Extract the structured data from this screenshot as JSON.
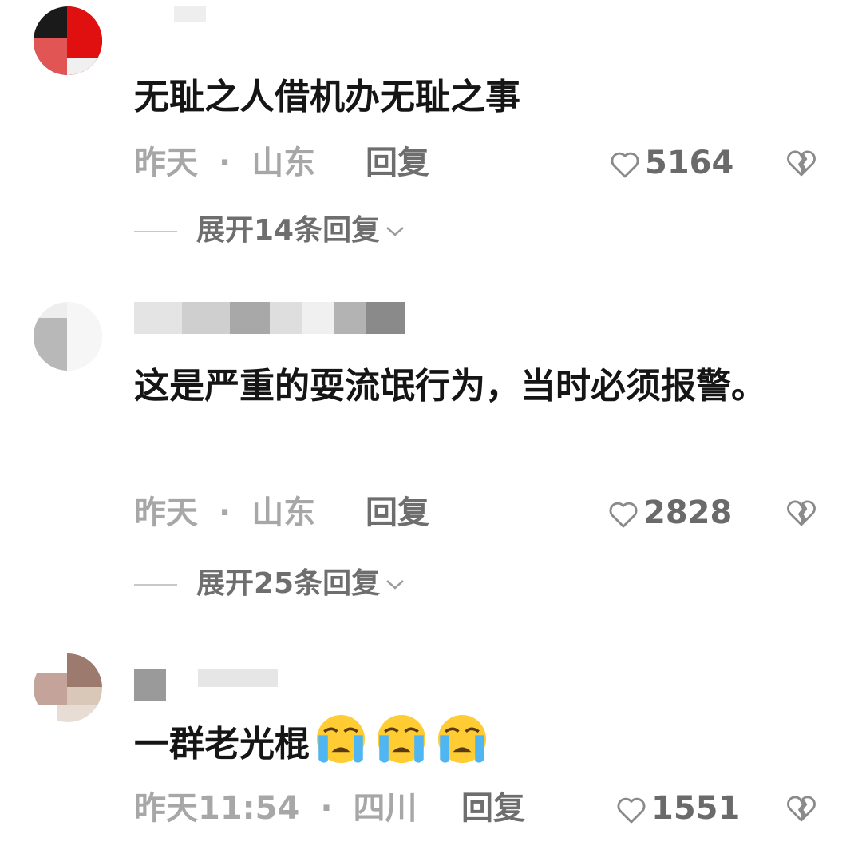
{
  "comments": [
    {
      "text": "无耻之人借机办无耻之事",
      "time": "昨天",
      "location": "山东",
      "reply_label": "回复",
      "likes": "5164",
      "expand_label": "展开14条回复"
    },
    {
      "text": "这是严重的耍流氓行为，当时必须报警。",
      "time": "昨天",
      "location": "山东",
      "reply_label": "回复",
      "likes": "2828",
      "expand_label": "展开25条回复"
    },
    {
      "text": "一群老光棍",
      "time": "昨天11:54",
      "location": "四川",
      "reply_label": "回复",
      "likes": "1551",
      "emoji": [
        "loudly-crying-face",
        "loudly-crying-face",
        "loudly-crying-face"
      ]
    }
  ],
  "icons": {
    "like": "heart-outline-icon",
    "dislike": "broken-heart-icon",
    "expand": "chevron-down-icon"
  },
  "colors": {
    "text": "#151515",
    "meta": "#a7a7a7",
    "action": "#6e6e6e",
    "background": "#ffffff"
  }
}
